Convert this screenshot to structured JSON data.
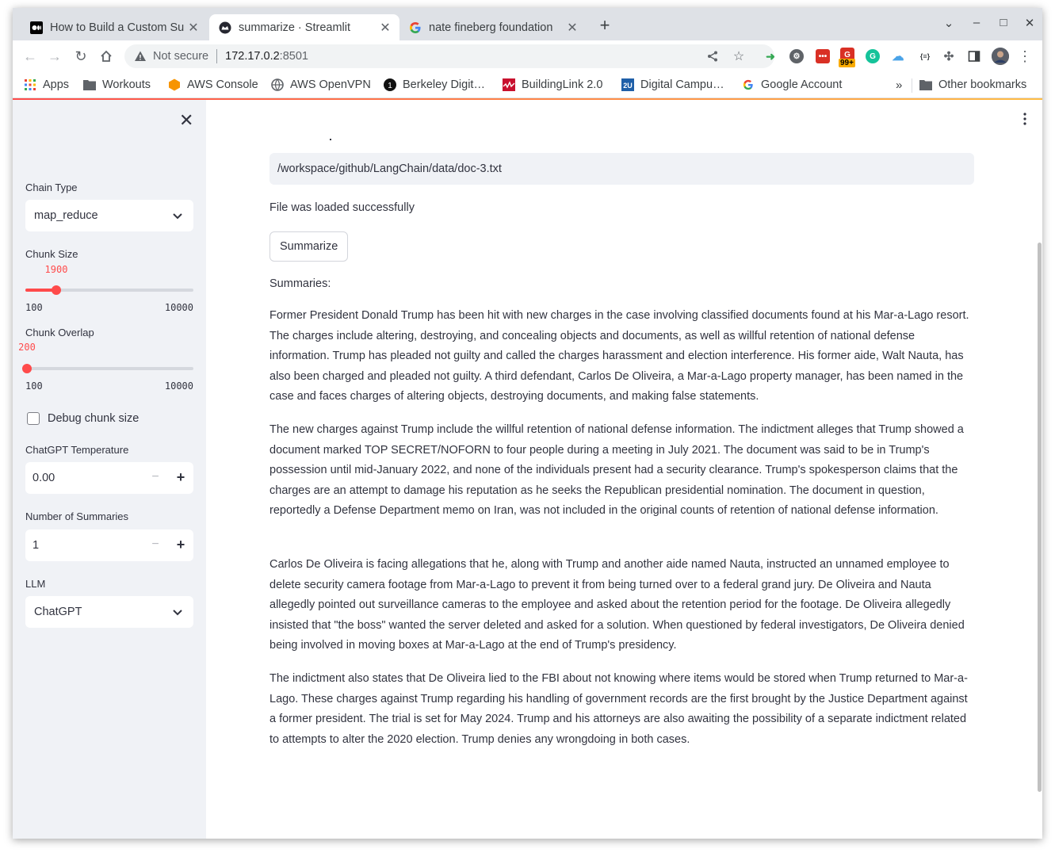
{
  "browser": {
    "tabs": [
      {
        "title": "How to Build a Custom Su",
        "favicon": "medium-icon",
        "active": false
      },
      {
        "title": "summarize · Streamlit",
        "favicon": "streamlit-icon",
        "active": true
      },
      {
        "title": "nate fineberg foundation",
        "favicon": "google-icon",
        "active": false
      }
    ],
    "address": {
      "security_label": "Not secure",
      "host": "172.17.0.2",
      "port": ":8501"
    },
    "extension_badge": "99+",
    "bookmarks": [
      {
        "label": "Apps",
        "icon": "apps-grid-icon"
      },
      {
        "label": "Workouts",
        "icon": "folder-icon"
      },
      {
        "label": "AWS Console",
        "icon": "aws-icon"
      },
      {
        "label": "AWS OpenVPN",
        "icon": "openvpn-icon"
      },
      {
        "label": "Berkeley Digit…",
        "icon": "berkeley-icon"
      },
      {
        "label": "BuildingLink 2.0",
        "icon": "buildinglink-icon"
      },
      {
        "label": "Digital Campu…",
        "icon": "2u-icon"
      },
      {
        "label": "Google Account",
        "icon": "google-icon"
      }
    ],
    "bookmarks_overflow": "»",
    "other_bookmarks": "Other bookmarks"
  },
  "sidebar": {
    "chain_type": {
      "label": "Chain Type",
      "value": "map_reduce"
    },
    "chunk_size": {
      "label": "Chunk Size",
      "value": "1900",
      "min": "100",
      "max": "10000",
      "fraction": 0.182
    },
    "chunk_overlap": {
      "label": "Chunk Overlap",
      "value": "200",
      "min": "100",
      "max": "10000",
      "fraction": 0.01
    },
    "debug": {
      "label": "Debug chunk size",
      "checked": false
    },
    "temperature": {
      "label": "ChatGPT Temperature",
      "value": "0.00"
    },
    "num_summaries": {
      "label": "Number of Summaries",
      "value": "1"
    },
    "llm": {
      "label": "LLM",
      "value": "ChatGPT"
    }
  },
  "main": {
    "file_path": "/workspace/github/LangChain/data/doc-3.txt",
    "status": "File was loaded successfully",
    "summarize_button": "Summarize",
    "summaries_label": "Summaries:",
    "paragraphs": [
      "Former President Donald Trump has been hit with new charges in the case involving classified documents found at his Mar-a-Lago resort. The charges include altering, destroying, and concealing objects and documents, as well as willful retention of national defense information. Trump has pleaded not guilty and called the charges harassment and election interference. His former aide, Walt Nauta, has also been charged and pleaded not guilty. A third defendant, Carlos De Oliveira, a Mar-a-Lago property manager, has been named in the case and faces charges of altering objects, destroying documents, and making false statements.",
      "The new charges against Trump include the willful retention of national defense information. The indictment alleges that Trump showed a document marked TOP SECRET/NOFORN to four people during a meeting in July 2021. The document was said to be in Trump's possession until mid-January 2022, and none of the individuals present had a security clearance. Trump's spokesperson claims that the charges are an attempt to damage his reputation as he seeks the Republican presidential nomination. The document in question, reportedly a Defense Department memo on Iran, was not included in the original counts of retention of national defense information.",
      "Carlos De Oliveira is facing allegations that he, along with Trump and another aide named Nauta, instructed an unnamed employee to delete security camera footage from Mar-a-Lago to prevent it from being turned over to a federal grand jury. De Oliveira and Nauta allegedly pointed out surveillance cameras to the employee and asked about the retention period for the footage. De Oliveira allegedly insisted that \"the boss\" wanted the server deleted and asked for a solution. When questioned by federal investigators, De Oliveira denied being involved in moving boxes at Mar-a-Lago at the end of Trump's presidency.",
      "The indictment also states that De Oliveira lied to the FBI about not knowing where items would be stored when Trump returned to Mar-a-Lago. These charges against Trump regarding his handling of government records are the first brought by the Justice Department against a former president. The trial is set for May 2024. Trump and his attorneys are also awaiting the possibility of a separate indictment related to attempts to alter the 2020 election. Trump denies any wrongdoing in both cases."
    ]
  },
  "colors": {
    "accent": "#ff4b4b",
    "sidebar_bg": "#f0f2f6",
    "text": "#31333f"
  }
}
